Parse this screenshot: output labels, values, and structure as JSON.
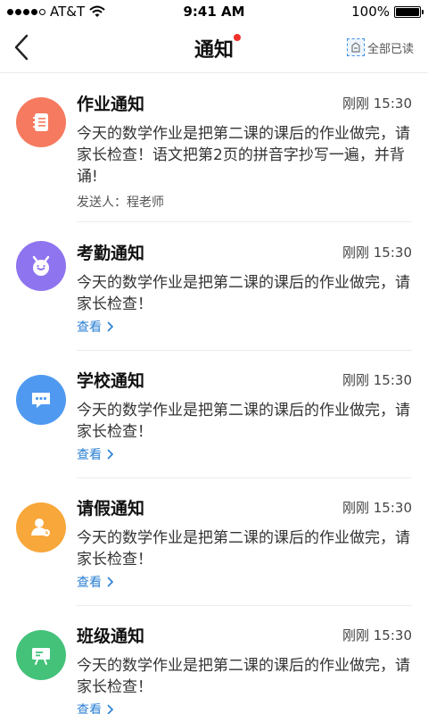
{
  "status_bar": {
    "carrier": "AT&T",
    "time": "9:41 AM",
    "battery": "100%",
    "battery_level": 1.0
  },
  "nav": {
    "title": "通知",
    "mark_all_read": "全部已读"
  },
  "notifications": [
    {
      "title": "作业通知",
      "time": "刚刚 15:30",
      "content": "今天的数学作业是把第二课的课后的作业做完，请家长检查！语文把第2页的拼音字抄写一遍，并背诵!",
      "sender": "发送人：程老师",
      "icon": "notebook-icon",
      "color": "#f57a5f"
    },
    {
      "title": "考勤通知",
      "time": "刚刚 15:30",
      "content": "今天的数学作业是把第二课的课后的作业做完，请家长检查！",
      "link": "查看",
      "icon": "alarm-clock-icon",
      "color": "#8f74ef"
    },
    {
      "title": "学校通知",
      "time": "刚刚 15:30",
      "content": "今天的数学作业是把第二课的课后的作业做完，请家长检查！",
      "link": "查看",
      "icon": "chat-bubble-icon",
      "color": "#4f9af0"
    },
    {
      "title": "请假通知",
      "time": "刚刚 15:30",
      "content": "今天的数学作业是把第二课的课后的作业做完，请家长检查！",
      "link": "查看",
      "icon": "person-leave-icon",
      "color": "#f8a73a"
    },
    {
      "title": "班级通知",
      "time": "刚刚 15:30",
      "content": "今天的数学作业是把第二课的课后的作业做完，请家长检查！",
      "link": "查看",
      "icon": "blackboard-icon",
      "color": "#44c27a"
    }
  ]
}
